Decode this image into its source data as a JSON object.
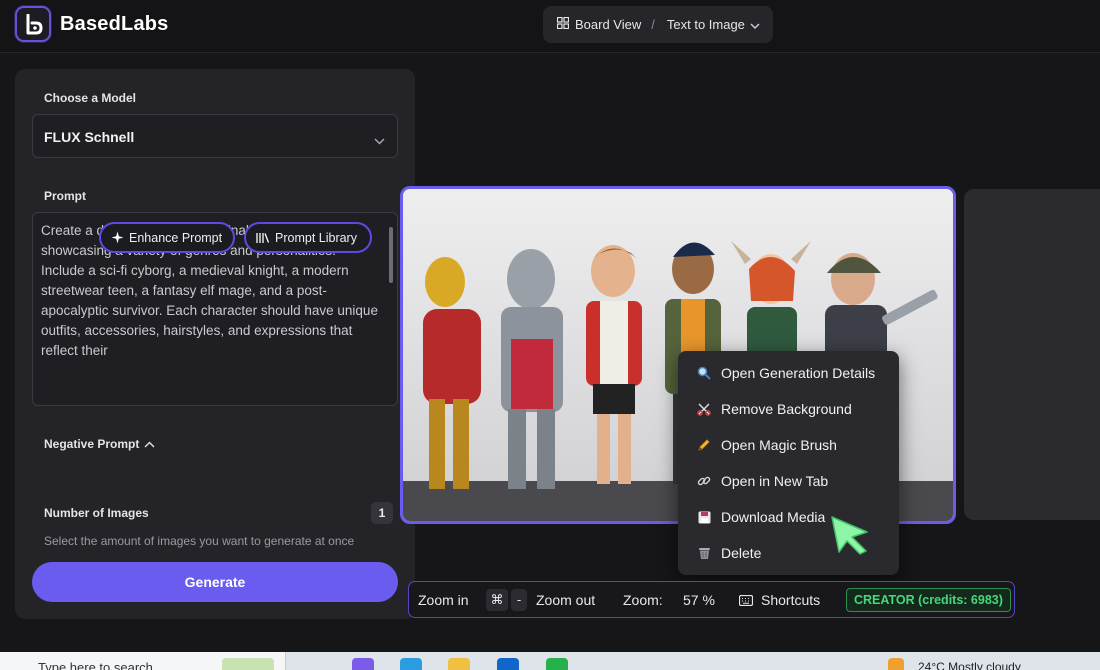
{
  "app": {
    "brand": "BasedLabs",
    "view_switch": {
      "board_view": "Board View",
      "separator": "/",
      "mode": "Text to Image"
    }
  },
  "panel": {
    "model_label": "Choose a Model",
    "model_value": "FLUX Schnell",
    "prompt_label": "Prompt",
    "prompt_text": "Create a dynamic lineup of original character designs showcasing a variety of genres and personalities. Include a sci-fi cyborg, a medieval knight, a modern streetwear teen, a fantasy elf mage, and a post-apocalyptic survivor. Each character should have unique outfits, accessories, hairstyles, and expressions that reflect their",
    "enhance_label": "Enhance Prompt",
    "library_label": "Prompt Library",
    "negative_label": "Negative Prompt",
    "num_images_label": "Number of Images",
    "num_images_value": "1",
    "num_images_desc": "Select the amount of images you want to generate at once",
    "generate_label": "Generate"
  },
  "context_menu": {
    "items": [
      {
        "label": "Open Generation Details",
        "icon": "magnifier-icon"
      },
      {
        "label": "Remove Background",
        "icon": "scissors-icon"
      },
      {
        "label": "Open Magic Brush",
        "icon": "pencil-icon"
      },
      {
        "label": "Open in New Tab",
        "icon": "link-icon"
      },
      {
        "label": "Download Media",
        "icon": "floppy-disk-icon"
      },
      {
        "label": "Delete",
        "icon": "trash-icon"
      }
    ]
  },
  "toolbar": {
    "zoom_in": "Zoom in",
    "cmd_key": "⌘",
    "minus_key": "-",
    "zoom_out": "Zoom out",
    "zoom_label": "Zoom:",
    "zoom_value": "57 %",
    "shortcuts": "Shortcuts",
    "credits": "CREATOR (credits: 6983)"
  },
  "taskbar": {
    "search_placeholder": "Type here to search",
    "weather": "24°C  Mostly cloudy"
  },
  "colors": {
    "accent": "#6a5cef",
    "credits_green": "#46d87a",
    "cursor_green": "#8ef5a6"
  }
}
